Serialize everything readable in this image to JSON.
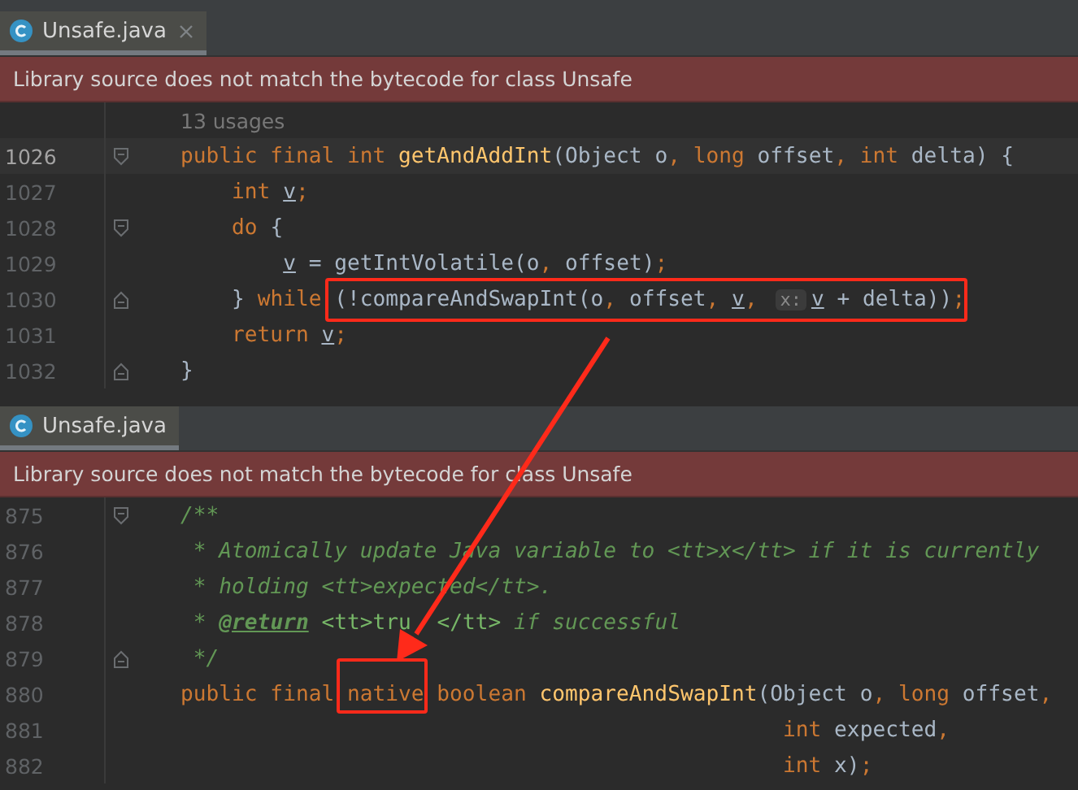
{
  "panes": [
    {
      "tab": {
        "title": "Unsafe.java",
        "closable": true
      },
      "banner": "Library source does not match the bytecode for class Unsafe",
      "usages": "13 usages",
      "lines": [
        {
          "number": "1026",
          "current": true,
          "gutter_icon": {
            "kind": "fold-start"
          },
          "tokens": [
            {
              "text": "public final int ",
              "kind": "kw"
            },
            {
              "text": "getAndAddInt",
              "kind": "fn"
            },
            {
              "text": "(Object o",
              "kind": "plain"
            },
            {
              "text": ", ",
              "kind": "punct"
            },
            {
              "text": "long ",
              "kind": "kw"
            },
            {
              "text": "offset",
              "kind": "plain"
            },
            {
              "text": ", ",
              "kind": "punct"
            },
            {
              "text": "int ",
              "kind": "kw"
            },
            {
              "text": "delta) {",
              "kind": "plain"
            }
          ]
        },
        {
          "number": "1027",
          "current": false,
          "tokens": [
            {
              "text": "    int ",
              "kind": "kw"
            },
            {
              "text": "v",
              "kind": "var"
            },
            {
              "text": ";",
              "kind": "punct"
            }
          ]
        },
        {
          "number": "1028",
          "current": false,
          "gutter_icon": {
            "kind": "fold-start"
          },
          "tokens": [
            {
              "text": "    do ",
              "kind": "kw"
            },
            {
              "text": "{",
              "kind": "plain"
            }
          ]
        },
        {
          "number": "1029",
          "current": false,
          "tokens": [
            {
              "text": "        v",
              "kind": "var"
            },
            {
              "text": " = getIntVolatile(o",
              "kind": "plain"
            },
            {
              "text": ", ",
              "kind": "punct"
            },
            {
              "text": "offset)",
              "kind": "plain"
            },
            {
              "text": ";",
              "kind": "punct"
            }
          ]
        },
        {
          "number": "1030",
          "current": false,
          "gutter_icon": {
            "kind": "fold-end"
          },
          "tokens": [
            {
              "text": "    } ",
              "kind": "plain"
            },
            {
              "text": "while ",
              "kind": "kw"
            },
            {
              "text": "(!compareAndSwapInt(o",
              "kind": "plain"
            },
            {
              "text": ", ",
              "kind": "punct"
            },
            {
              "text": "offset",
              "kind": "plain"
            },
            {
              "text": ", ",
              "kind": "punct"
            },
            {
              "text": "v",
              "kind": "var"
            },
            {
              "text": ", ",
              "kind": "punct"
            },
            {
              "text": "x:",
              "kind": "hint"
            },
            {
              "text": "v",
              "kind": "var"
            },
            {
              "text": " + delta))",
              "kind": "plain"
            },
            {
              "text": ";",
              "kind": "punct"
            }
          ]
        },
        {
          "number": "1031",
          "current": false,
          "tokens": [
            {
              "text": "    return ",
              "kind": "kw"
            },
            {
              "text": "v",
              "kind": "var"
            },
            {
              "text": ";",
              "kind": "punct"
            }
          ]
        },
        {
          "number": "1032",
          "current": false,
          "gutter_icon": {
            "kind": "fold-end"
          },
          "tokens": [
            {
              "text": "}",
              "kind": "plain"
            }
          ]
        }
      ]
    },
    {
      "tab": {
        "title": "Unsafe.java",
        "closable": false
      },
      "banner": "Library source does not match the bytecode for class Unsafe",
      "lines": [
        {
          "number": "875",
          "current": false,
          "gutter_icon": {
            "kind": "fold-start"
          },
          "tokens": [
            {
              "text": "/**",
              "kind": "comment"
            }
          ]
        },
        {
          "number": "876",
          "current": false,
          "tokens": [
            {
              "text": " * Atomically update Java variable to <tt>x</tt> if it is currently",
              "kind": "comment"
            }
          ]
        },
        {
          "number": "877",
          "current": false,
          "tokens": [
            {
              "text": " * holding <tt>expected</tt>.",
              "kind": "comment"
            }
          ]
        },
        {
          "number": "878",
          "current": false,
          "tokens": [
            {
              "text": " * ",
              "kind": "comment"
            },
            {
              "text": "@return",
              "kind": "doctag"
            },
            {
              "text": " <tt>tru",
              "kind": "commenttag",
              "obscured": true
            },
            {
              "text": "</tt> ",
              "kind": "commenttag"
            },
            {
              "text": "if successful",
              "kind": "comment"
            }
          ]
        },
        {
          "number": "879",
          "current": false,
          "gutter_icon": {
            "kind": "fold-end"
          },
          "tokens": [
            {
              "text": " */",
              "kind": "comment"
            }
          ]
        },
        {
          "number": "880",
          "current": false,
          "tokens": [
            {
              "text": "public final native boolean ",
              "kind": "kw"
            },
            {
              "text": "compareAndSwapInt",
              "kind": "fn"
            },
            {
              "text": "(Object o",
              "kind": "plain"
            },
            {
              "text": ", ",
              "kind": "punct"
            },
            {
              "text": "long ",
              "kind": "kw"
            },
            {
              "text": "offset",
              "kind": "plain"
            },
            {
              "text": ",",
              "kind": "punct"
            }
          ]
        },
        {
          "number": "881",
          "current": false,
          "tokens": [
            {
              "text": "                                               int ",
              "kind": "kw"
            },
            {
              "text": "expected",
              "kind": "plain"
            },
            {
              "text": ",",
              "kind": "punct"
            }
          ]
        },
        {
          "number": "882",
          "current": false,
          "tokens": [
            {
              "text": "                                               int ",
              "kind": "kw"
            },
            {
              "text": "x)",
              "kind": "plain"
            },
            {
              "text": ";",
              "kind": "punct"
            }
          ]
        }
      ]
    }
  ]
}
